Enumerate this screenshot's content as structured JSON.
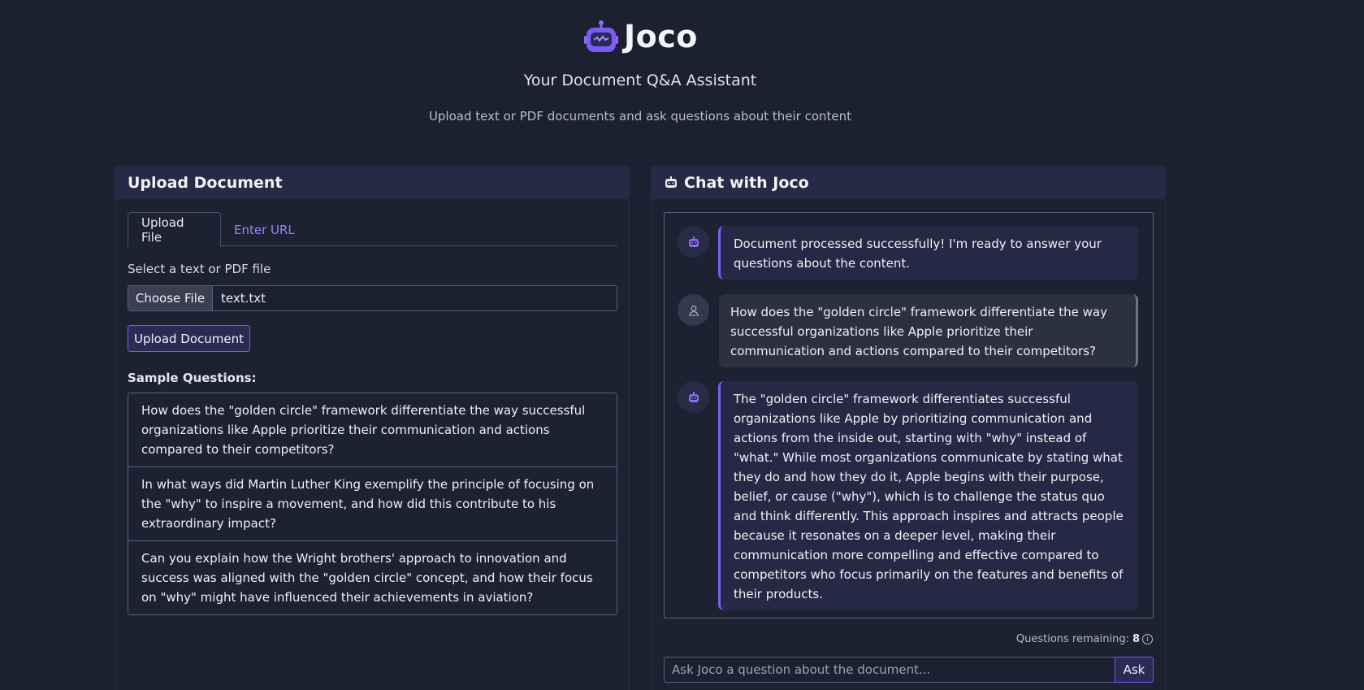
{
  "header": {
    "brand": "Joco",
    "tagline": "Your Document Q&A Assistant",
    "subline": "Upload text or PDF documents and ask questions about their content"
  },
  "upload": {
    "title": "Upload Document",
    "tabs": [
      {
        "label": "Upload File",
        "active": true
      },
      {
        "label": "Enter URL",
        "active": false
      }
    ],
    "select_label": "Select a text or PDF file",
    "choose_file_label": "Choose File",
    "file_name": "text.txt",
    "upload_button": "Upload Document",
    "sample_title": "Sample Questions:",
    "samples": [
      "How does the \"golden circle\" framework differentiate the way successful organizations like Apple prioritize their communication and actions compared to their competitors?",
      "In what ways did Martin Luther King exemplify the principle of focusing on the \"why\" to inspire a movement, and how did this contribute to his extraordinary impact?",
      "Can you explain how the Wright brothers' approach to innovation and success was aligned with the \"golden circle\" concept, and how their focus on \"why\" might have influenced their achievements in aviation?"
    ]
  },
  "chat": {
    "title": "Chat with Joco",
    "messages": [
      {
        "role": "bot",
        "avatar_icon": "robot-icon",
        "text": "Document processed successfully! I'm ready to answer your questions about the content."
      },
      {
        "role": "user",
        "avatar_icon": "user-icon",
        "text": "How does the \"golden circle\" framework differentiate the way successful organizations like Apple prioritize their communication and actions compared to their competitors?"
      },
      {
        "role": "bot",
        "avatar_icon": "robot-icon",
        "text": "The \"golden circle\" framework differentiates successful organizations like Apple by prioritizing communication and actions from the inside out, starting with \"why\" instead of \"what.\" While most organizations communicate by stating what they do and how they do it, Apple begins with their purpose, belief, or cause (\"why\"), which is to challenge the status quo and think differently. This approach inspires and attracts people because it resonates on a deeper level, making their communication more compelling and effective compared to competitors who focus primarily on the features and benefits of their products."
      }
    ],
    "remaining_label": "Questions remaining:",
    "remaining_count": "8",
    "ask_placeholder": "Ask Joco a question about the document...",
    "ask_button": "Ask"
  },
  "colors": {
    "background": "#1c2131",
    "panel_header": "#262a45",
    "accent": "#7b5cf5",
    "link": "#9a82ff"
  }
}
